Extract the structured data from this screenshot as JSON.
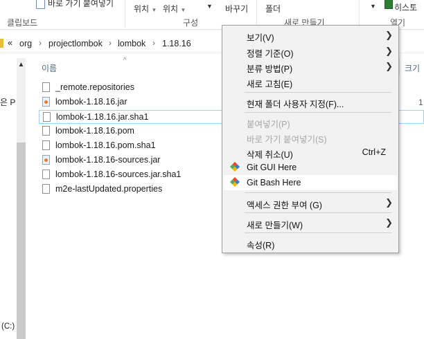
{
  "ribbon": {
    "copy_path_label": "바로 가기 붙여넣기",
    "location_label": "위치",
    "location2_label": "위치",
    "rename_label": "바꾸기",
    "folder_label": "폴더",
    "history_label": "히스토",
    "clipboard_group": "클립보드",
    "organize_group": "구성",
    "new_group": "새로 만들기",
    "open_group": "열기"
  },
  "address": {
    "overflow": "«",
    "crumbs": [
      "org",
      "projectlombok",
      "lombok",
      "1.18.16"
    ]
  },
  "left": {
    "truncated_text": "은 P",
    "drive_label": "(C:)"
  },
  "list": {
    "name_header": "이름",
    "size_header": "크기",
    "size_value": "1",
    "files": [
      {
        "name": "_remote.repositories",
        "type": "file"
      },
      {
        "name": "lombok-1.18.16.jar",
        "type": "jar"
      },
      {
        "name": "lombok-1.18.16.jar.sha1",
        "type": "file"
      },
      {
        "name": "lombok-1.18.16.pom",
        "type": "file"
      },
      {
        "name": "lombok-1.18.16.pom.sha1",
        "type": "file"
      },
      {
        "name": "lombok-1.18.16-sources.jar",
        "type": "jar"
      },
      {
        "name": "lombok-1.18.16-sources.jar.sha1",
        "type": "file"
      },
      {
        "name": "m2e-lastUpdated.properties",
        "type": "file"
      }
    ],
    "selected_index": 2
  },
  "context_menu": {
    "view": "보기(V)",
    "sort_by": "정렬 기준(O)",
    "group_by": "분류 방법(P)",
    "refresh": "새로 고침(E)",
    "customize": "현재 폴더 사용자 지정(F)...",
    "paste": "붙여넣기(P)",
    "paste_shortcut": "바로 가기 붙여넣기(S)",
    "undo_delete": "삭제 취소(U)",
    "undo_shortcut_key": "Ctrl+Z",
    "git_gui": "Git GUI Here",
    "git_bash": "Git Bash Here",
    "give_access": "액세스 권한 부여 (G)",
    "new": "새로 만들기(W)",
    "properties": "속성(R)"
  },
  "colors": {
    "selection_border": "#99d1ff",
    "header_text": "#4d6b8a",
    "git_red": "#e84d31",
    "git_blue": "#2f7fd0",
    "git_green": "#4caf50",
    "git_yellow": "#f2b705"
  },
  "icons": [
    "copy-icon",
    "history-icon",
    "folder-icon",
    "file-icon",
    "jar-icon",
    "git-icon",
    "chevron-right-icon",
    "chevron-up-icon"
  ]
}
